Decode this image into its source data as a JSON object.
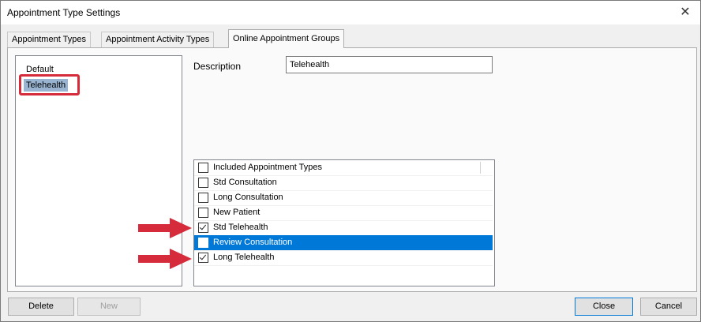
{
  "window": {
    "title": "Appointment Type Settings",
    "close_glyph": "✕"
  },
  "tabs": [
    {
      "label": "Appointment Types",
      "active": false
    },
    {
      "label": "Appointment Activity Types",
      "active": false
    },
    {
      "label": "Online Appointment Groups",
      "active": true
    }
  ],
  "groups": [
    {
      "label": "Default",
      "selected": false
    },
    {
      "label": "Telehealth",
      "selected": true
    }
  ],
  "description": {
    "label": "Description",
    "value": "Telehealth"
  },
  "types_list": {
    "header": {
      "label": "Included Appointment Types",
      "checked": false
    },
    "items": [
      {
        "label": "Std Consultation",
        "checked": false,
        "selected": false
      },
      {
        "label": "Long Consultation",
        "checked": false,
        "selected": false
      },
      {
        "label": "New Patient",
        "checked": false,
        "selected": false
      },
      {
        "label": "Std Telehealth",
        "checked": true,
        "selected": false
      },
      {
        "label": "Review Consultation",
        "checked": false,
        "selected": true
      },
      {
        "label": "Long Telehealth",
        "checked": true,
        "selected": false
      }
    ]
  },
  "buttons": {
    "delete": "Delete",
    "new": "New",
    "close": "Close",
    "cancel": "Cancel"
  },
  "colors": {
    "selection": "#0078d7",
    "annotation_red": "#d52b3a",
    "list_selected": "#99b4d1"
  }
}
